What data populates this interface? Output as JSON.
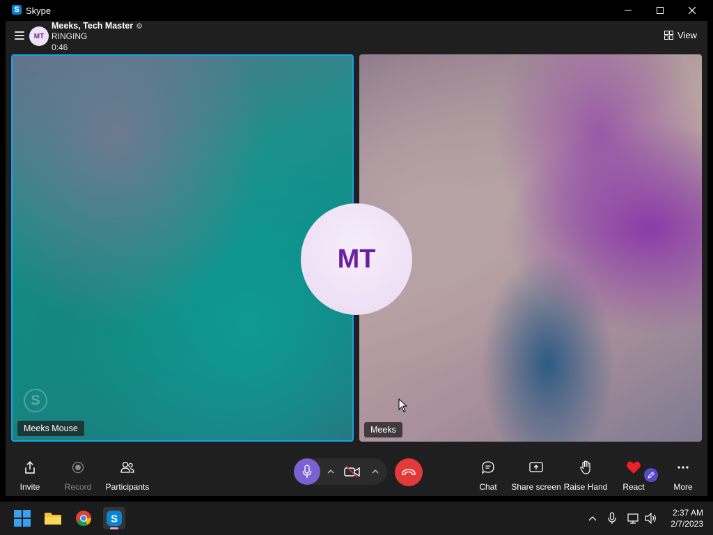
{
  "window": {
    "app_title": "Skype",
    "app_icon": "skype-icon"
  },
  "header": {
    "avatar_initials": "MT",
    "call_title": "Meeks, Tech Master",
    "call_status": "RINGING",
    "call_duration": "0:46",
    "view_label": "View"
  },
  "tiles": {
    "left_label": "Meeks Mouse",
    "right_label": "Meeks",
    "center_avatar_initials": "MT"
  },
  "controls": {
    "invite": "Invite",
    "record": "Record",
    "participants": "Participants",
    "chat": "Chat",
    "share_screen": "Share screen",
    "raise_hand": "Raise Hand",
    "react": "React",
    "more": "More"
  },
  "colors": {
    "accent": "#7b61d4",
    "hangup": "#e23a3a",
    "active_tile_border": "#1aa0e6",
    "react_heart": "#e8202a"
  },
  "taskbar": {
    "time": "2:37 AM",
    "date": "2/7/2023"
  }
}
